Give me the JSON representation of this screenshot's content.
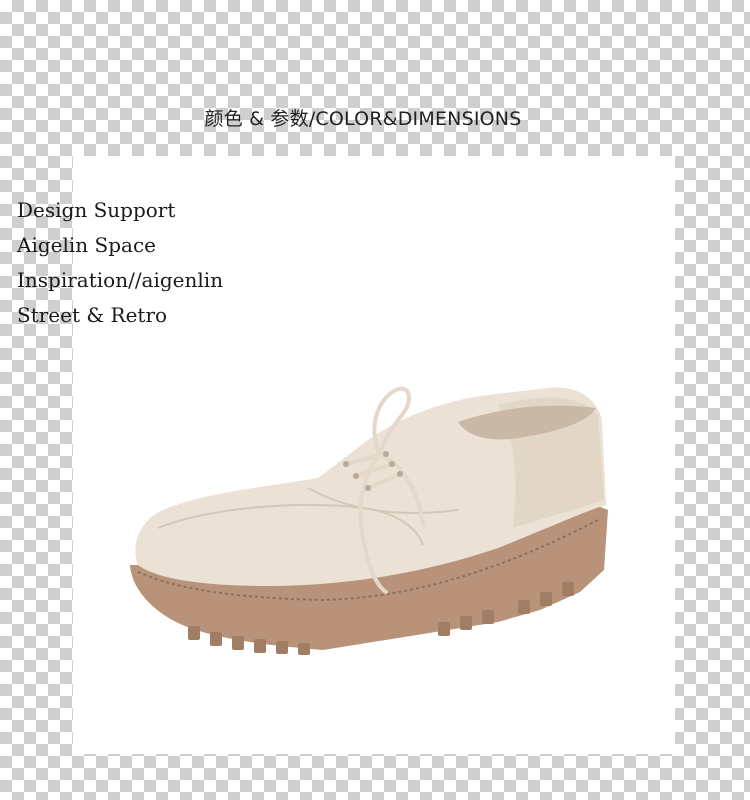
{
  "header": {
    "title": "颜色 & 参数/COLOR&DIMENSIONS"
  },
  "taglines": [
    "Design Support",
    "Aigelin Space",
    "Inspiration//aigenlin",
    "Street & Retro"
  ],
  "colors": {
    "upper": "#ebe1d4",
    "sole": "#b8937a",
    "lace": "#e4d8c9"
  }
}
